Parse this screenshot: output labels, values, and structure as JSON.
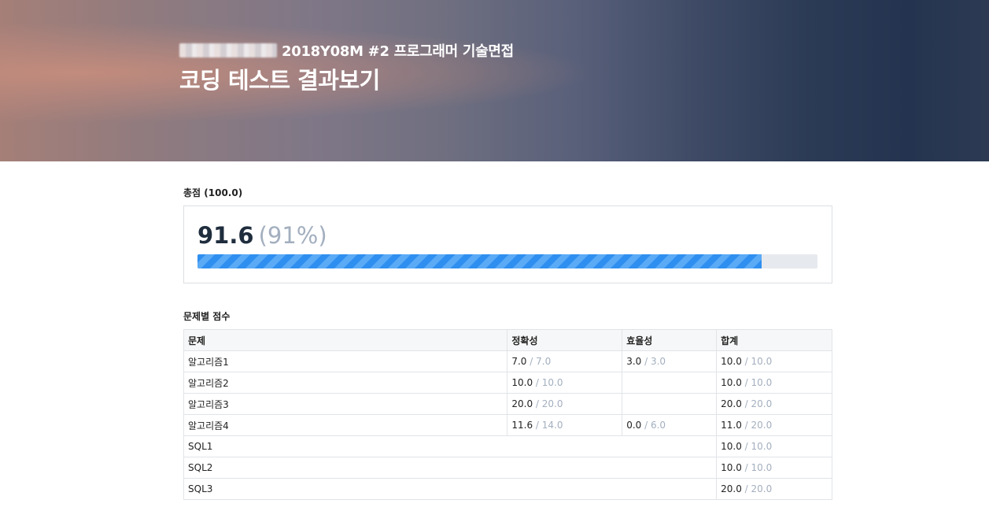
{
  "header": {
    "subtitle": "2018Y08M #2 프로그래머 기술면접",
    "title": "코딩 테스트 결과보기"
  },
  "total": {
    "label": "총점 (100.0)",
    "score": "91.6",
    "percent_text": "(91%)",
    "progress_fraction": 0.91
  },
  "problems": {
    "label": "문제별 점수",
    "columns": [
      "문제",
      "정확성",
      "효율성",
      "합계"
    ],
    "rows": [
      {
        "name": "알고리즘1",
        "accuracy": "7.0",
        "accuracy_max": "7.0",
        "efficiency": "3.0",
        "efficiency_max": "3.0",
        "total": "10.0",
        "total_max": "10.0"
      },
      {
        "name": "알고리즘2",
        "accuracy": "10.0",
        "accuracy_max": "10.0",
        "efficiency": "",
        "efficiency_max": "",
        "total": "10.0",
        "total_max": "10.0"
      },
      {
        "name": "알고리즘3",
        "accuracy": "20.0",
        "accuracy_max": "20.0",
        "efficiency": "",
        "efficiency_max": "",
        "total": "20.0",
        "total_max": "20.0"
      },
      {
        "name": "알고리즘4",
        "accuracy": "11.6",
        "accuracy_max": "14.0",
        "efficiency": "0.0",
        "efficiency_max": "6.0",
        "total": "11.0",
        "total_max": "20.0"
      },
      {
        "name": "SQL1",
        "total": "10.0",
        "total_max": "10.0"
      },
      {
        "name": "SQL2",
        "total": "10.0",
        "total_max": "10.0"
      },
      {
        "name": "SQL3",
        "total": "20.0",
        "total_max": "20.0"
      }
    ]
  },
  "colors": {
    "progress": "#2f8ff0",
    "muted": "#a3afbf"
  }
}
